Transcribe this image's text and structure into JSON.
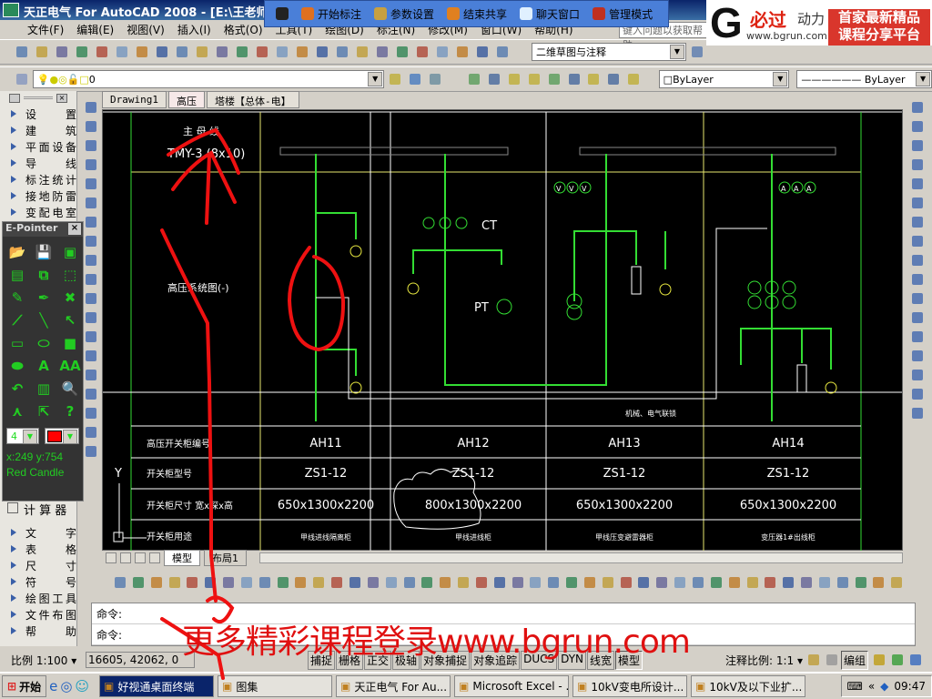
{
  "window": {
    "title": "天正电气 For AutoCAD 2008 - [E:\\王老师\\7.27\\"
  },
  "share_bar": {
    "items": [
      {
        "label": "",
        "icon": "pen-icon",
        "color": "#222"
      },
      {
        "label": "开始标注",
        "icon": "pencil-icon",
        "color": "#e07020"
      },
      {
        "label": "参数设置",
        "icon": "settings-icon",
        "color": "#c8a040"
      },
      {
        "label": "结束共享",
        "icon": "stop-share-icon",
        "color": "#e08020"
      },
      {
        "label": "聊天窗口",
        "icon": "chat-icon",
        "color": "#e0f0ff"
      },
      {
        "label": "管理模式",
        "icon": "admin-user-icon",
        "color": "#c03020"
      }
    ]
  },
  "logo": {
    "letter": "G",
    "cn": "必过",
    "cn2": "动力",
    "url": "www.bgrun.com",
    "slogan1": "首家最新精品",
    "slogan2": "课程分享平台"
  },
  "menu": [
    "文件(F)",
    "编辑(E)",
    "视图(V)",
    "插入(I)",
    "格式(O)",
    "工具(T)",
    "绘图(D)",
    "标注(N)",
    "修改(M)",
    "窗口(W)",
    "帮助(H)"
  ],
  "help_placeholder": "键入问题以获取帮助",
  "toolbar1": {
    "icons": [
      "new-icon",
      "open-icon",
      "save-icon",
      "plot-icon",
      "preview-icon",
      "publish-icon",
      "3d-icon",
      "cut-icon",
      "copy-icon",
      "paste-icon",
      "match-prop-icon",
      "block-icon",
      "undo-icon",
      "redo-icon",
      "pan-icon",
      "zoom-realtime-icon",
      "zoom-window-icon",
      "zoom-previous-icon",
      "properties-icon",
      "design-center-icon",
      "tool-palette-icon",
      "sheet-set-icon",
      "markup-icon",
      "calculator-icon",
      "help-icon"
    ],
    "workspace": "二维草图与注释"
  },
  "toolbar2": {
    "layer": "0",
    "color": "ByLayer",
    "linetype": "ByLayer"
  },
  "doc_tabs": [
    {
      "label": "Drawing1",
      "active": false
    },
    {
      "label": "高压",
      "active": true
    },
    {
      "label": "塔楼【总体-电】",
      "active": false
    }
  ],
  "palette": {
    "top_items": [
      "设　　置",
      "建　　筑",
      "平面设备",
      "导　　线",
      "标注统计",
      "接地防雷",
      "变配电室"
    ],
    "calc": "计 算 器",
    "bottom_items": [
      "文　　字",
      "表　　格",
      "尺　　寸",
      "符　　号",
      "绘图工具",
      "文件布图",
      "帮　　助"
    ]
  },
  "epointer": {
    "title": "E-Pointer",
    "close": "×",
    "tools": [
      "open-icon",
      "save-icon",
      "screen-icon",
      "paste-icon",
      "copy-icon",
      "select-rect-icon",
      "eraser-icon",
      "marker-icon",
      "clear-icon",
      "pencil-icon",
      "line-icon",
      "arrow-icon",
      "rectangle-icon",
      "ellipse-icon",
      "filled-rect-icon",
      "filled-ellipse-icon",
      "text-icon",
      "text-size-icon",
      "undo-icon",
      "whiteboard-icon",
      "magnifier-icon",
      "spotlight-icon",
      "pointer-icon",
      "help-icon"
    ],
    "tool_glyphs": [
      "📂",
      "💾",
      "▣",
      "▤",
      "⧉",
      "⬚",
      "✎",
      "✒",
      "✖",
      "⟋",
      "╲",
      "↖",
      "▭",
      "⬭",
      "■",
      "⬬",
      "A",
      "AA",
      "↶",
      "▥",
      "🔍",
      "⋏",
      "⇱",
      "?"
    ],
    "width_value": "4",
    "pen_color": "#ff0000",
    "coords": "x:249  y:754",
    "theme": "Red Candle"
  },
  "drawing": {
    "busbar_title": "主 母 线",
    "busbar_spec": "TMY-3 (8x10)",
    "system_title": "高压系统图(-)",
    "ct_label": "CT",
    "pt_label": "PT",
    "meters_v": [
      "V",
      "V",
      "V"
    ],
    "meters_a": [
      "A",
      "A",
      "A"
    ],
    "interlock": "机械、电气联锁",
    "ucs_y": "Y",
    "table": {
      "row_headers": [
        "高压开关柜编号",
        "开关柜型号",
        "开关柜尺寸  宽x深x高",
        "开关柜用途"
      ],
      "columns": [
        {
          "id": "AH11",
          "model": "ZS1-12",
          "size": "650x1300x2200",
          "use": "甲线进线隔离柜"
        },
        {
          "id": "AH12",
          "model": "ZS1-12",
          "size": "800x1300x2200",
          "use": "甲线进线柜"
        },
        {
          "id": "AH13",
          "model": "ZS1-12",
          "size": "650x1300x2200",
          "use": "甲线压变避雷器柜"
        },
        {
          "id": "AH14",
          "model": "ZS1-12",
          "size": "650x1300x2200",
          "use": "变压器1#出线柜"
        }
      ]
    },
    "colors": {
      "bus": "#33dd33",
      "frame_yellow": "#e8e870",
      "white": "#ffffff",
      "annotation": "#ee1111"
    }
  },
  "model_tabs": [
    "模型",
    "布局1"
  ],
  "command": {
    "lines": [
      "命令:",
      "命令:"
    ]
  },
  "status": {
    "scale": "比例 1:100 ▾",
    "coords": "16605, 42062, 0",
    "toggles": [
      {
        "label": "捕捉",
        "on": false
      },
      {
        "label": "栅格",
        "on": false
      },
      {
        "label": "正交",
        "on": false
      },
      {
        "label": "极轴",
        "on": false
      },
      {
        "label": "对象捕捉",
        "on": false
      },
      {
        "label": "对象追踪",
        "on": false
      },
      {
        "label": "DUCS",
        "on": false
      },
      {
        "label": "DYN",
        "on": false
      },
      {
        "label": "线宽",
        "on": false
      },
      {
        "label": "模型",
        "on": true
      }
    ],
    "anno_scale": "注释比例: 1:1 ▾",
    "group": "编组"
  },
  "taskbar": {
    "start": "开始",
    "tasks": [
      {
        "label": "好视通桌面终端",
        "active": true,
        "icon": "meeting-icon"
      },
      {
        "label": "图集",
        "active": false,
        "icon": "folder-icon"
      },
      {
        "label": "天正电气 For Au...",
        "active": false,
        "icon": "autocad-icon"
      },
      {
        "label": "Microsoft Excel - ...",
        "active": false,
        "icon": "excel-icon"
      },
      {
        "label": "10kV变电所设计...",
        "active": false,
        "icon": "pdf-icon"
      },
      {
        "label": "10kV及以下业扩...",
        "active": false,
        "icon": "document-icon"
      }
    ],
    "clock": "09:47"
  },
  "watermark": "更多精彩课程登录www.bgrun.com"
}
